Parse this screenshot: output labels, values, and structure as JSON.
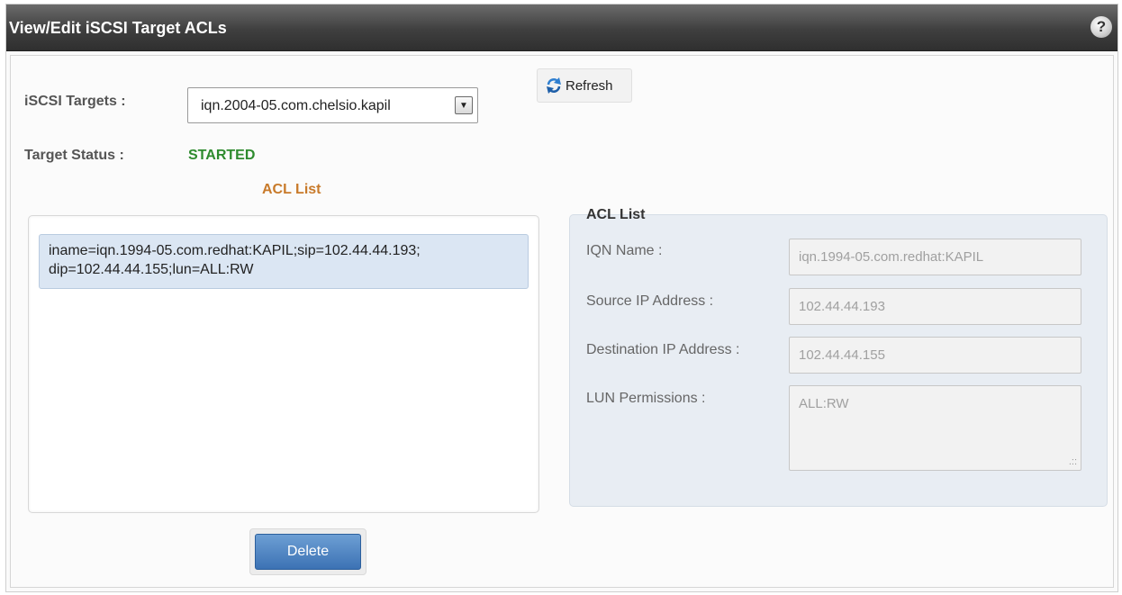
{
  "window": {
    "title": "View/Edit iSCSI Target ACLs",
    "help_glyph": "?"
  },
  "targets": {
    "label": "iSCSI Targets :",
    "selected": "iqn.2004-05.com.chelsio.kapil",
    "dropdown_glyph": "▼"
  },
  "refresh": {
    "label": "Refresh",
    "icon": "refresh-icon"
  },
  "status": {
    "label": "Target Status :",
    "value": "STARTED",
    "value_color": "#2e8b2e"
  },
  "acl_list": {
    "heading": "ACL List",
    "entries": [
      {
        "text": "iname=iqn.1994-05.com.redhat:KAPIL;sip=102.44.44.193;\ndip=102.44.44.155;lun=ALL:RW"
      }
    ]
  },
  "delete_button": {
    "label": "Delete"
  },
  "acl_form": {
    "title": "ACL List",
    "iqn_label": "IQN Name :",
    "iqn_value": "iqn.1994-05.com.redhat:KAPIL",
    "source_ip_label": "Source IP Address :",
    "source_ip_value": "102.44.44.193",
    "dest_ip_label": "Destination IP Address :",
    "dest_ip_value": "102.44.44.155",
    "lun_label": "LUN Permissions :",
    "lun_value": "ALL:RW",
    "resize_glyph": ".::"
  },
  "colors": {
    "titlebar": "#3f3f3f",
    "acl_heading": "#c87a2a",
    "selected_entry": "#dbe6f3",
    "delete_button": "#3c72b4",
    "form_background": "#e8edf3"
  }
}
